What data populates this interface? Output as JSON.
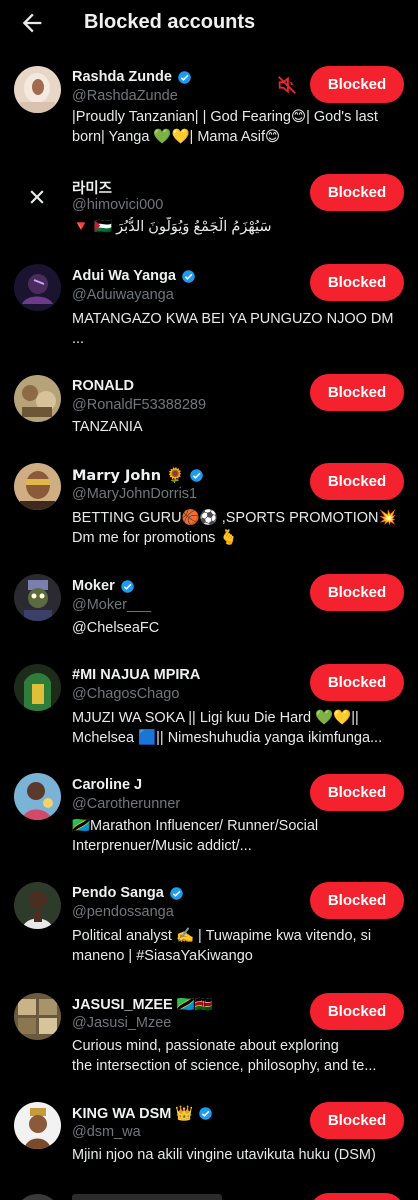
{
  "header": {
    "title": "Blocked accounts",
    "back_icon": "arrow-left-icon"
  },
  "colors": {
    "background": "#000000",
    "blocked_button": "#f4212e",
    "verified": "#1d9bf0",
    "handle": "#71767b",
    "muted_icon": "#f4212e"
  },
  "blocked_label": "Blocked",
  "accounts": [
    {
      "name": "Rashda Zunde",
      "verified": true,
      "handle": "@RashdaZunde",
      "muted": true,
      "bio_lines": [
        "|Proudly Tanzanian| | God Fearing😊| God's last",
        "born| Yanga 💚💛| Mama Asif😊"
      ]
    },
    {
      "name": "라미즈",
      "verified": false,
      "handle": "@himovici000",
      "avatar_icon": "x-close-icon",
      "bio_lines": [
        "سَيُهْزَمُ الْجَمْعُ وَيُوَلُّونَ الدُّبُرَ 🇵🇸 🔻"
      ]
    },
    {
      "name": "Adui Wa Yanga",
      "verified": true,
      "handle": "@Aduiwayanga",
      "bio_lines": [
        "MATANGAZO KWA BEI YA PUNGUZO NJOO DM",
        "..."
      ]
    },
    {
      "name": "RONALD",
      "verified": false,
      "handle": "@RonaldF53388289",
      "bio_lines": [
        "TANZANIA"
      ]
    },
    {
      "name": "Marry John 🌻",
      "verified": true,
      "handle": "@MaryJohnDorris1",
      "bio_lines": [
        "BETTING GURU🏀⚽ ,SPORTS PROMOTION💥",
        "Dm me for promotions 🫰"
      ]
    },
    {
      "name": "Moker",
      "verified": true,
      "handle": "@Moker___",
      "bio_lines": [
        "@ChelseaFC"
      ]
    },
    {
      "name": "#MI NAJUA MPIRA",
      "verified": false,
      "handle": "@ChagosChago",
      "bio_lines": [
        "MJUZI WA SOKA   || Ligi kuu Die Hard 💚💛||",
        "Mchelsea 🟦|| Nimeshuhudia yanga ikimfunga..."
      ]
    },
    {
      "name": "Caroline J",
      "verified": false,
      "handle": "@Carotherunner",
      "bio_lines": [
        "🇹🇿Marathon Influencer/ Runner/Social",
        "Interprenuer/Music addict/..."
      ]
    },
    {
      "name": "Pendo Sanga",
      "verified": true,
      "handle": "@pendossanga",
      "bio_lines": [
        "Political analyst ✍️ | Tuwapime kwa vitendo, si",
        "maneno | #SiasaYaKiwango"
      ]
    },
    {
      "name": "JASUSI_MZEE 🇹🇿🇰🇪",
      "verified": false,
      "handle": "@Jasusi_Mzee",
      "bio_lines": [
        "Curious mind, passionate about exploring",
        "the intersection of science, philosophy, and te..."
      ]
    },
    {
      "name": "KING WA DSM 👑",
      "verified": true,
      "handle": "@dsm_wa",
      "bio_lines": [
        "Mjini njoo na akili vingine utavikuta huku (DSM)"
      ]
    }
  ]
}
